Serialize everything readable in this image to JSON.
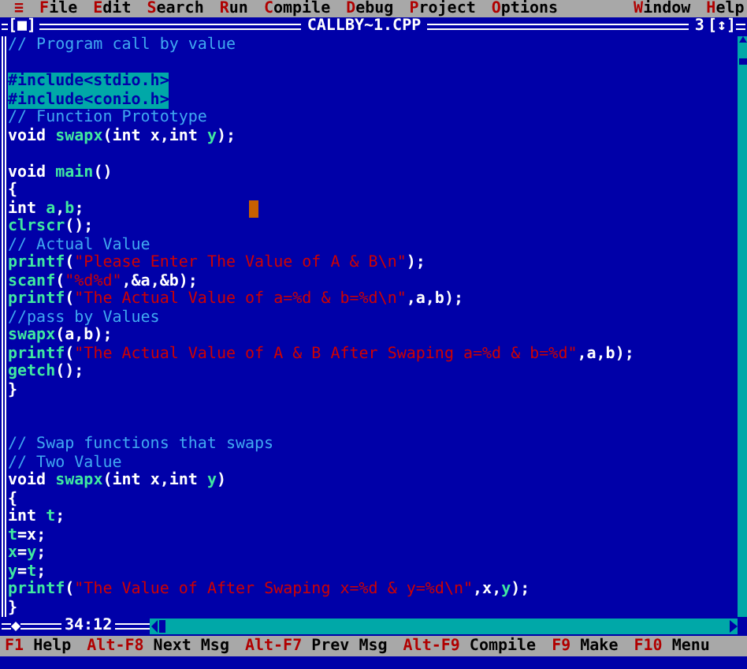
{
  "menu_bar": {
    "system": "≡",
    "items": [
      {
        "hotkey": "F",
        "rest": "ile"
      },
      {
        "hotkey": "E",
        "rest": "dit"
      },
      {
        "hotkey": "S",
        "rest": "earch"
      },
      {
        "hotkey": "R",
        "rest": "un"
      },
      {
        "hotkey": "C",
        "rest": "ompile"
      },
      {
        "hotkey": "D",
        "rest": "ebug"
      },
      {
        "hotkey": "P",
        "rest": "roject"
      },
      {
        "hotkey": "O",
        "rest": "ptions"
      },
      {
        "hotkey": "W",
        "rest": "indow"
      },
      {
        "hotkey": "H",
        "rest": "elp"
      }
    ]
  },
  "editor": {
    "close": "[■]",
    "title": "CALLBY~1.CPP",
    "window_number": "3",
    "zoom": "[↕]",
    "position": "34:12",
    "lines": [
      {
        "kind": "code",
        "marked": false,
        "segments": [
          {
            "text": "// Program call by value",
            "kind": "comment"
          }
        ]
      },
      {
        "kind": "blank"
      },
      {
        "kind": "code",
        "marked": true,
        "segments": [
          {
            "text": "#include<stdio.h>",
            "kind": "plain"
          }
        ]
      },
      {
        "kind": "code",
        "marked": true,
        "segments": [
          {
            "text": "#include<conio.h>",
            "kind": "plain"
          }
        ]
      },
      {
        "kind": "code",
        "marked": false,
        "segments": [
          {
            "text": "// Function Prototype",
            "kind": "comment"
          }
        ]
      },
      {
        "kind": "code",
        "marked": false,
        "segments": [
          {
            "text": "void ",
            "kind": "plain"
          },
          {
            "text": "swapx",
            "kind": "name"
          },
          {
            "text": "(int x,int ",
            "kind": "plain"
          },
          {
            "text": "y",
            "kind": "name"
          },
          {
            "text": ");",
            "kind": "plain"
          }
        ]
      },
      {
        "kind": "blank"
      },
      {
        "kind": "code",
        "marked": false,
        "segments": [
          {
            "text": "void ",
            "kind": "plain"
          },
          {
            "text": "main",
            "kind": "name"
          },
          {
            "text": "()",
            "kind": "plain"
          }
        ]
      },
      {
        "kind": "code",
        "marked": false,
        "segments": [
          {
            "text": "{",
            "kind": "plain"
          }
        ]
      },
      {
        "kind": "code",
        "marked": false,
        "segments": [
          {
            "text": "int ",
            "kind": "plain"
          },
          {
            "text": "a",
            "kind": "name"
          },
          {
            "text": ",",
            "kind": "plain"
          },
          {
            "text": "b",
            "kind": "name"
          },
          {
            "text": ";",
            "kind": "plain"
          }
        ]
      },
      {
        "kind": "code",
        "marked": false,
        "segments": [
          {
            "text": "clrscr",
            "kind": "name"
          },
          {
            "text": "();",
            "kind": "plain"
          }
        ]
      },
      {
        "kind": "code",
        "marked": false,
        "segments": [
          {
            "text": "// Actual Value",
            "kind": "comment"
          }
        ]
      },
      {
        "kind": "code",
        "marked": false,
        "segments": [
          {
            "text": "printf",
            "kind": "name"
          },
          {
            "text": "(",
            "kind": "plain"
          },
          {
            "text": "\"Please Enter The Value of A & B\\n\"",
            "kind": "string"
          },
          {
            "text": ");",
            "kind": "plain"
          }
        ]
      },
      {
        "kind": "code",
        "marked": false,
        "segments": [
          {
            "text": "scanf",
            "kind": "name"
          },
          {
            "text": "(",
            "kind": "plain"
          },
          {
            "text": "\"%d%d\"",
            "kind": "string"
          },
          {
            "text": ",&a,&b);",
            "kind": "plain"
          }
        ]
      },
      {
        "kind": "code",
        "marked": false,
        "segments": [
          {
            "text": "printf",
            "kind": "name"
          },
          {
            "text": "(",
            "kind": "plain"
          },
          {
            "text": "\"The Actual Value of a=%d & b=%d\\n\"",
            "kind": "string"
          },
          {
            "text": ",a,b);",
            "kind": "plain"
          }
        ]
      },
      {
        "kind": "code",
        "marked": false,
        "segments": [
          {
            "text": "//pass by Values",
            "kind": "comment"
          }
        ]
      },
      {
        "kind": "code",
        "marked": false,
        "segments": [
          {
            "text": "swapx",
            "kind": "name"
          },
          {
            "text": "(a,b);",
            "kind": "plain"
          }
        ]
      },
      {
        "kind": "code",
        "marked": false,
        "segments": [
          {
            "text": "printf",
            "kind": "name"
          },
          {
            "text": "(",
            "kind": "plain"
          },
          {
            "text": "\"The Actual Value of A & B After Swaping a=%d & b=%d\"",
            "kind": "string"
          },
          {
            "text": ",a,b);",
            "kind": "plain"
          }
        ]
      },
      {
        "kind": "code",
        "marked": false,
        "segments": [
          {
            "text": "getch",
            "kind": "name"
          },
          {
            "text": "();",
            "kind": "plain"
          }
        ]
      },
      {
        "kind": "code",
        "marked": false,
        "segments": [
          {
            "text": "}",
            "kind": "plain"
          }
        ]
      },
      {
        "kind": "blank"
      },
      {
        "kind": "blank"
      },
      {
        "kind": "code",
        "marked": false,
        "segments": [
          {
            "text": "// Swap functions that swaps",
            "kind": "comment"
          }
        ]
      },
      {
        "kind": "code",
        "marked": false,
        "segments": [
          {
            "text": "// Two Value",
            "kind": "comment"
          }
        ]
      },
      {
        "kind": "code",
        "marked": false,
        "segments": [
          {
            "text": "void ",
            "kind": "plain"
          },
          {
            "text": "swapx",
            "kind": "name"
          },
          {
            "text": "(int x,int ",
            "kind": "plain"
          },
          {
            "text": "y",
            "kind": "name"
          },
          {
            "text": ")",
            "kind": "plain"
          }
        ]
      },
      {
        "kind": "code",
        "marked": false,
        "segments": [
          {
            "text": "{",
            "kind": "plain"
          }
        ]
      },
      {
        "kind": "code",
        "marked": false,
        "segments": [
          {
            "text": "int ",
            "kind": "plain"
          },
          {
            "text": "t",
            "kind": "name"
          },
          {
            "text": ";",
            "kind": "plain"
          }
        ]
      },
      {
        "kind": "code",
        "marked": false,
        "segments": [
          {
            "text": "t",
            "kind": "name"
          },
          {
            "text": "=x;",
            "kind": "plain"
          }
        ]
      },
      {
        "kind": "code",
        "marked": false,
        "segments": [
          {
            "text": "x",
            "kind": "name"
          },
          {
            "text": "=",
            "kind": "plain"
          },
          {
            "text": "y",
            "kind": "name"
          },
          {
            "text": ";",
            "kind": "plain"
          }
        ]
      },
      {
        "kind": "code",
        "marked": false,
        "segments": [
          {
            "text": "y",
            "kind": "name"
          },
          {
            "text": "=",
            "kind": "plain"
          },
          {
            "text": "t",
            "kind": "name"
          },
          {
            "text": ";",
            "kind": "plain"
          }
        ]
      },
      {
        "kind": "code",
        "marked": false,
        "segments": [
          {
            "text": "printf",
            "kind": "name"
          },
          {
            "text": "(",
            "kind": "plain"
          },
          {
            "text": "\"The Value of After Swaping x=%d & y=%d\\n\"",
            "kind": "string"
          },
          {
            "text": ",x,",
            "kind": "plain"
          },
          {
            "text": "y",
            "kind": "name"
          },
          {
            "text": ");",
            "kind": "plain"
          }
        ]
      },
      {
        "kind": "code",
        "marked": false,
        "segments": [
          {
            "text": "}",
            "kind": "plain"
          }
        ]
      }
    ]
  },
  "status_bar": [
    {
      "key": "F1",
      "label": "Help"
    },
    {
      "key": "Alt-F8",
      "label": "Next Msg"
    },
    {
      "key": "Alt-F7",
      "label": "Prev Msg"
    },
    {
      "key": "Alt-F9",
      "label": "Compile"
    },
    {
      "key": "F9",
      "label": "Make"
    },
    {
      "key": "F10",
      "label": "Menu"
    }
  ]
}
